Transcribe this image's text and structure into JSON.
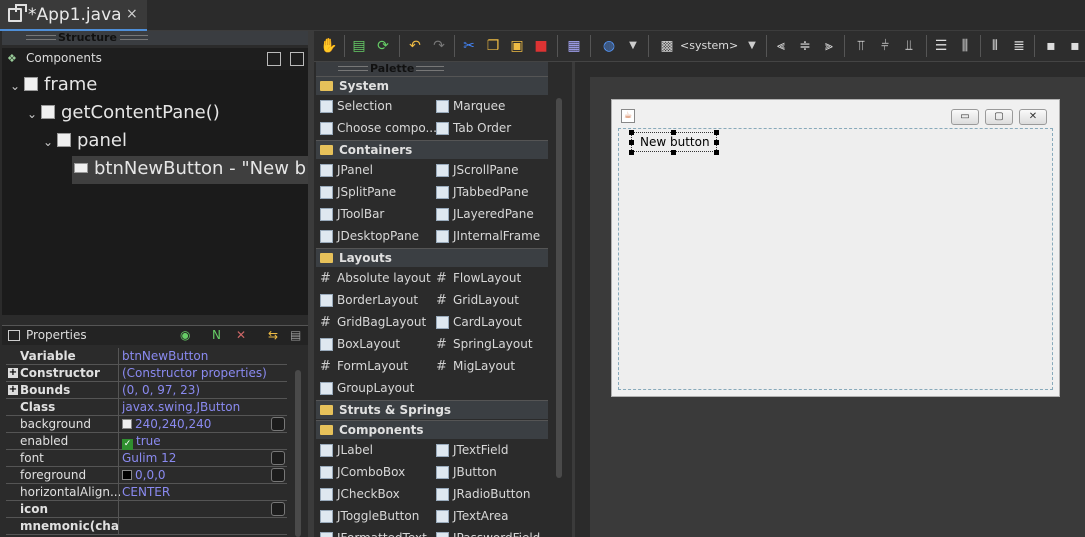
{
  "editor": {
    "tab_title": "*App1.java",
    "tab_close": "×"
  },
  "structure": {
    "header": "Structure",
    "components_label": "Components",
    "tree": [
      {
        "label": "frame"
      },
      {
        "label": "getContentPane()"
      },
      {
        "label": "panel"
      },
      {
        "label": "btnNewButton - \"New b"
      }
    ]
  },
  "properties": {
    "header": "Properties",
    "rows": [
      {
        "name": "Variable",
        "value": "btnNewButton",
        "bold": true
      },
      {
        "name": "Constructor",
        "value": "(Constructor properties)",
        "bold": true,
        "expandable": true
      },
      {
        "name": "Bounds",
        "value": "(0, 0, 97, 23)",
        "bold": true,
        "expandable": true
      },
      {
        "name": "Class",
        "value": "javax.swing.JButton",
        "bold": true
      },
      {
        "name": "background",
        "value": "240,240,240",
        "swatch": "#f0f0f0"
      },
      {
        "name": "enabled",
        "value": "true",
        "check": true
      },
      {
        "name": "font",
        "value": "Gulim 12"
      },
      {
        "name": "foreground",
        "value": "0,0,0",
        "swatch": "#000000"
      },
      {
        "name": "horizontalAlign...",
        "value": "CENTER"
      },
      {
        "name": "icon",
        "value": "",
        "bold": true
      },
      {
        "name": "mnemonic(char)",
        "value": "",
        "bold": true
      }
    ]
  },
  "toolbar": {
    "system_label": "<system>"
  },
  "palette": {
    "header": "Palette",
    "categories": [
      {
        "label": "System",
        "items": [
          "Selection",
          "Marquee",
          "Choose compo...",
          "Tab Order"
        ]
      },
      {
        "label": "Containers",
        "items": [
          "JPanel",
          "JScrollPane",
          "JSplitPane",
          "JTabbedPane",
          "JToolBar",
          "JLayeredPane",
          "JDesktopPane",
          "JInternalFrame"
        ]
      },
      {
        "label": "Layouts",
        "items": [
          "Absolute layout",
          "FlowLayout",
          "BorderLayout",
          "GridLayout",
          "GridBagLayout",
          "CardLayout",
          "BoxLayout",
          "SpringLayout",
          "FormLayout",
          "MigLayout",
          "GroupLayout"
        ]
      },
      {
        "label": "Struts & Springs",
        "items": []
      },
      {
        "label": "Components",
        "items": [
          "JLabel",
          "JTextField",
          "JComboBox",
          "JButton",
          "JCheckBox",
          "JRadioButton",
          "JToggleButton",
          "JTextArea",
          "JFormattedText",
          "JPasswordField"
        ]
      }
    ]
  },
  "designer": {
    "button_text": "New button",
    "min_glyph": "▭",
    "max_glyph": "▢",
    "close_glyph": "✕"
  },
  "colors": {
    "accent": "#4f8fd8",
    "property_value": "#8a8af0",
    "folder": "#e6c15a"
  }
}
